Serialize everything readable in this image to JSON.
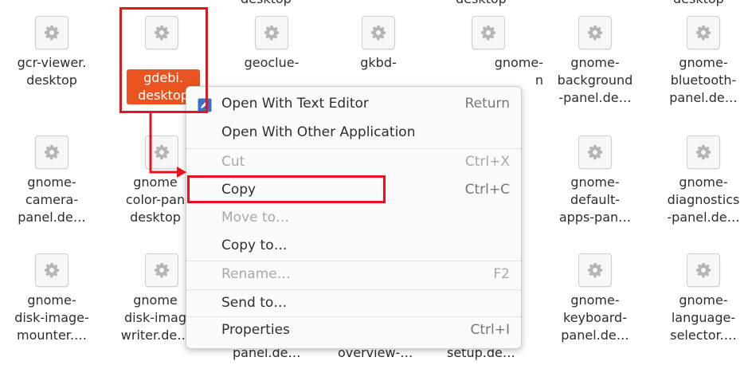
{
  "top_row_labels": [
    "desktop",
    "desktop",
    "desktop"
  ],
  "files": [
    {
      "name": "gcr-viewer.\ndesktop"
    },
    {
      "name": "gdebi.\ndesktop"
    },
    {
      "name": "geoclue-"
    },
    {
      "name": "gkbd-"
    },
    {
      "name": "gnome-\nn"
    },
    {
      "name": "gnome-\nbackground\n-panel.de…"
    },
    {
      "name": "gnome-\nbluetooth-\npanel.de…"
    },
    {
      "name": "gnome-\ncamera-\npanel.de…"
    },
    {
      "name": "gnome\ncolor-pan\ndesktop"
    },
    {
      "name": "gnome-\ndefault-\napps-pan…"
    },
    {
      "name": "gnome-\ndiagnostics\n-panel.de…"
    },
    {
      "name": "gnome-\ndisk-image-\nmounter.…"
    },
    {
      "name": "gnome\ndisk-imag\nwriter.de…"
    },
    {
      "name": "panel.de…"
    },
    {
      "name": "overview-…"
    },
    {
      "name": "setup.de…"
    },
    {
      "name": "gnome-\nkeyboard-\npanel.de…"
    },
    {
      "name": "gnome-\nlanguage-\nselector.…"
    }
  ],
  "context_menu": {
    "items": [
      {
        "label": "Open With Text Editor",
        "shortcut": "Return",
        "disabled": false
      },
      {
        "label": "Open With Other Application",
        "shortcut": "",
        "disabled": false
      },
      {
        "label": "Cut",
        "shortcut": "Ctrl+X",
        "disabled": true
      },
      {
        "label": "Copy",
        "shortcut": "Ctrl+C",
        "disabled": false
      },
      {
        "label": "Move to…",
        "shortcut": "",
        "disabled": true
      },
      {
        "label": "Copy to…",
        "shortcut": "",
        "disabled": false
      },
      {
        "label": "Rename…",
        "shortcut": "F2",
        "disabled": true
      },
      {
        "label": "Send to…",
        "shortcut": "",
        "disabled": false
      },
      {
        "label": "Properties",
        "shortcut": "Ctrl+I",
        "disabled": false
      }
    ]
  },
  "colors": {
    "selection": "#e95420",
    "annotation": "#e6121c"
  }
}
